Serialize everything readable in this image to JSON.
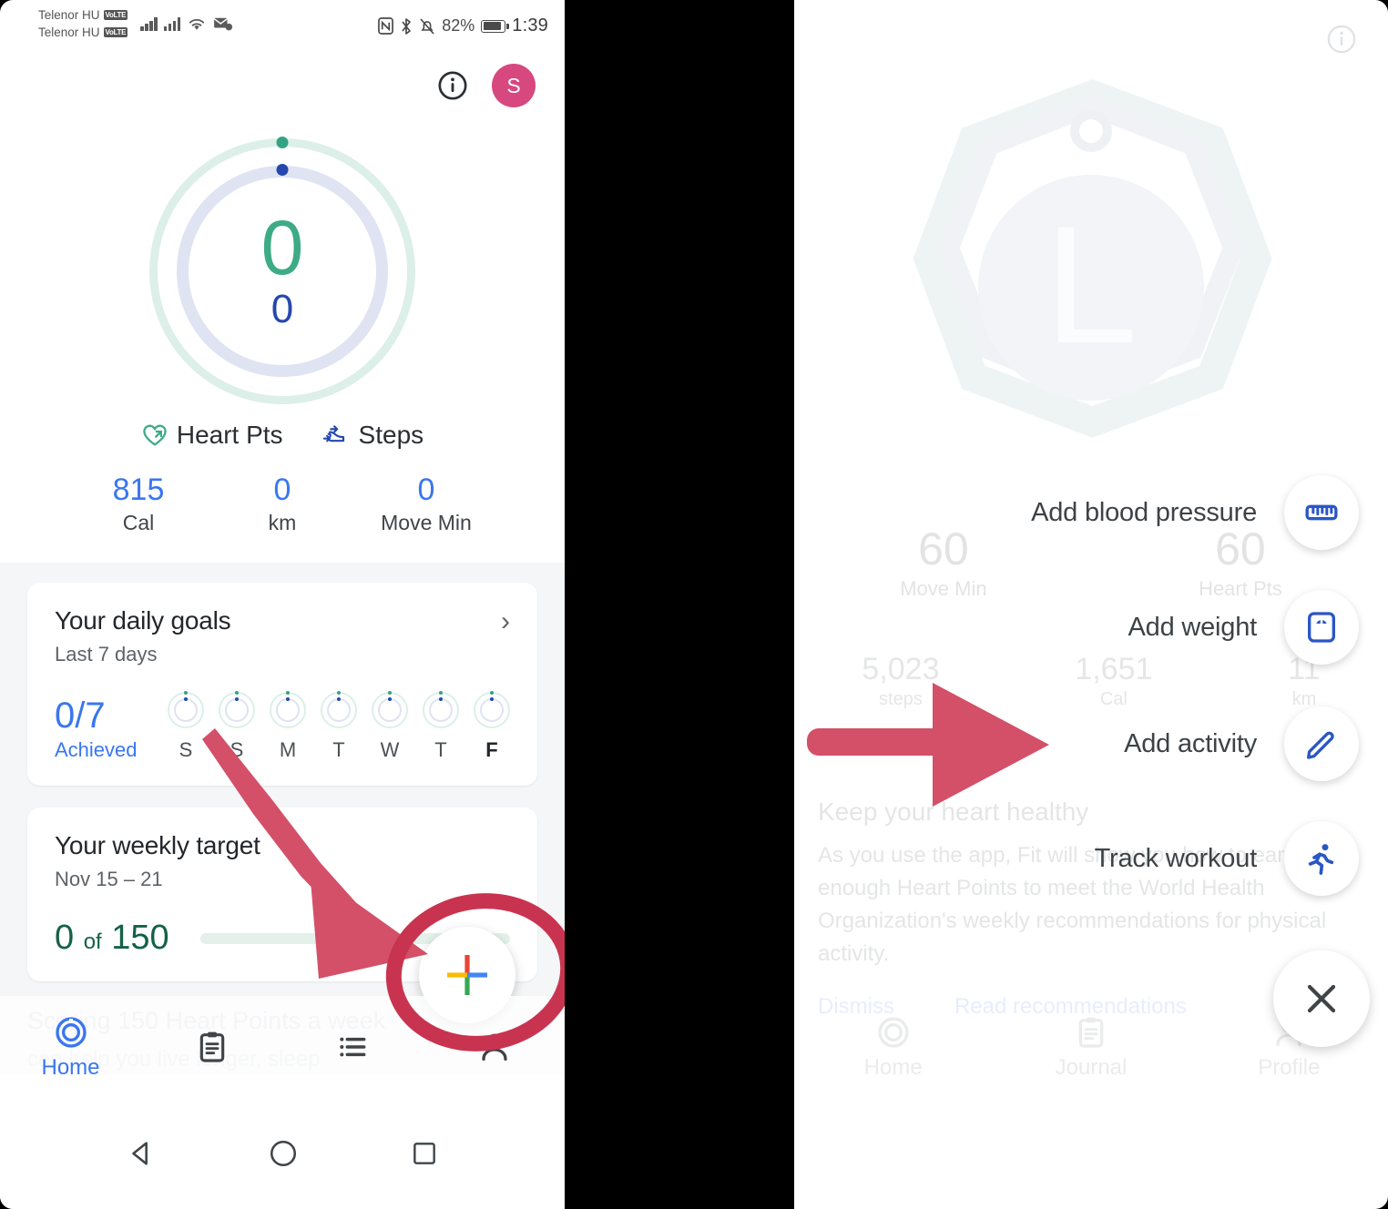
{
  "statusbar": {
    "carrier1": "Telenor HU",
    "carrier2": "Telenor HU",
    "volte": "VoLTE",
    "battery_percent": "82%",
    "clock": "1:39",
    "nfc": "N",
    "bluetooth": "✻",
    "mute": "silent-bell-icon"
  },
  "left": {
    "header": {
      "info_label": "i",
      "avatar_initial": "S",
      "avatar_color": "#d6487e"
    },
    "rings": {
      "heart_points_value": "0",
      "steps_value": "0",
      "heart_ring_color": "#dcefe8",
      "steps_ring_color": "#dfe3f2",
      "heart_accent": "#3eab87",
      "steps_accent": "#2548ad"
    },
    "legend": [
      {
        "label": "Heart Pts",
        "icon": "heart-arrow-icon"
      },
      {
        "label": "Steps",
        "icon": "shoe-icon"
      }
    ],
    "stats": [
      {
        "value": "815",
        "label": "Cal"
      },
      {
        "value": "0",
        "label": "km"
      },
      {
        "value": "0",
        "label": "Move Min"
      }
    ],
    "daily_goals": {
      "title": "Your daily goals",
      "subtitle": "Last 7 days",
      "achieved_value": "0/7",
      "achieved_label": "Achieved",
      "days": [
        "S",
        "S",
        "M",
        "T",
        "W",
        "T",
        "F"
      ],
      "today_index": 6
    },
    "weekly_target": {
      "title": "Your weekly target",
      "subtitle": "Nov 15 – 21",
      "value": "0",
      "of": "of",
      "goal": "150",
      "progress_percent": 0
    },
    "promo": {
      "title": "Scoring 150 Heart Points a week",
      "text": "can help you live longer, sleep"
    },
    "fab": {
      "label": "add-plus",
      "colors": [
        "#ea4335",
        "#4285f4",
        "#34a853",
        "#fbbc05"
      ]
    },
    "bottomnav": [
      {
        "label": "Home",
        "icon": "activity-ring-icon",
        "active": true
      },
      {
        "label": "",
        "icon": "clipboard-icon",
        "active": false
      },
      {
        "label": "",
        "icon": "list-icon",
        "active": false
      },
      {
        "label": "",
        "icon": "person-icon",
        "active": false
      }
    ],
    "sysnav": [
      "back-triangle",
      "home-circle",
      "recents-square"
    ]
  },
  "right": {
    "faded": {
      "badge_letter": "L",
      "metrics": [
        {
          "value": "60",
          "label": "Move Min"
        },
        {
          "value": "60",
          "label": "Heart Pts"
        }
      ],
      "row2": [
        {
          "value": "5,023",
          "label": "steps"
        },
        {
          "value": "1,651",
          "label": "Cal"
        },
        {
          "value": "11",
          "label": "km"
        }
      ],
      "card_title": "Keep your heart healthy",
      "card_body": "As you use the app, Fit will show you how to earn enough Heart Points to meet the World Health Organization's weekly recommendations for physical activity.",
      "card_actions": [
        "Dismiss",
        "Read recommendations"
      ],
      "bottomnav": [
        "Home",
        "Journal",
        "Profile"
      ]
    },
    "sheet": {
      "items": [
        {
          "label": "Add blood pressure",
          "icon": "blood-pressure-cuff-icon"
        },
        {
          "label": "Add weight",
          "icon": "weight-scale-icon"
        },
        {
          "label": "Add activity",
          "icon": "pencil-icon"
        },
        {
          "label": "Track workout",
          "icon": "running-person-icon"
        }
      ],
      "close_label": "close-x",
      "icon_color": "#2a56c6"
    }
  },
  "annotation": {
    "color": "#d35068"
  }
}
